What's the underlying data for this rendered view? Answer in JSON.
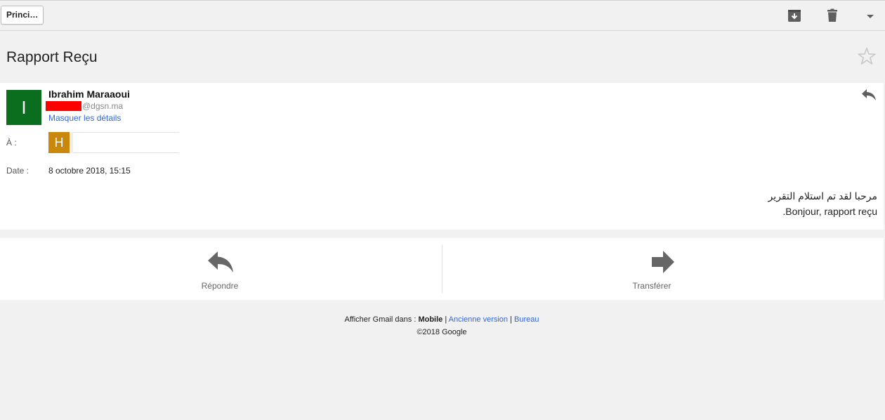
{
  "toolbar": {
    "back_label": "Princi…",
    "archive_icon": "archive-icon",
    "trash_icon": "trash-icon",
    "menu_icon": "caret-down-icon"
  },
  "message": {
    "subject": "Rapport Reçu",
    "sender": {
      "initial": "I",
      "name": "Ibrahim Maraaoui",
      "email_domain": "@dgsn.ma",
      "avatar_color": "#0b6e1e"
    },
    "hide_details": "Masquer les détails",
    "to_label": "À :",
    "recipient_initial": "H",
    "recipient_color": "#c9870b",
    "date_label": "Date :",
    "date_value": "8 octobre 2018, 15:15",
    "body_lines": [
      "مرحبا لقد تم استلام التقرير",
      "Bonjour, rapport reçu."
    ]
  },
  "actions": {
    "reply_label": "Répondre",
    "forward_label": "Transférer"
  },
  "footer": {
    "prefix": "Afficher Gmail dans : ",
    "mobile": "Mobile",
    "sep": " | ",
    "old_version": "Ancienne version",
    "desktop": "Bureau",
    "copyright": "©2018 Google"
  },
  "colors": {
    "link": "#3367d6",
    "redaction": "#ff0000"
  }
}
